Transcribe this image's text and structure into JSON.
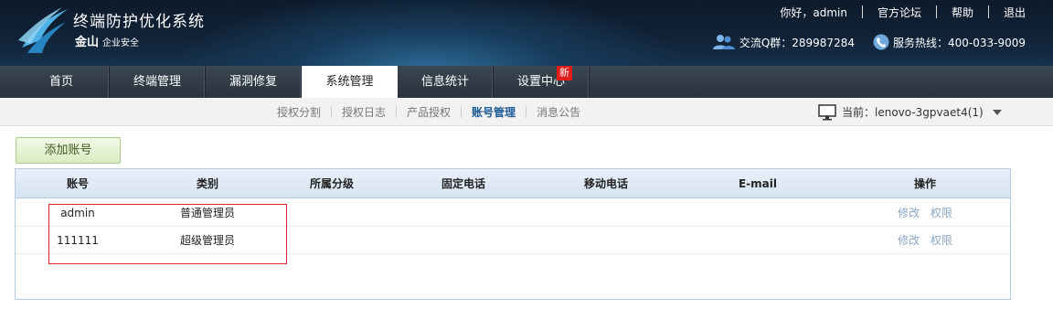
{
  "header": {
    "app_title": "终端防护优化系统",
    "brand": "金山",
    "brand_sub": "企业安全",
    "greeting": "你好，admin",
    "links": [
      "官方论坛",
      "帮助",
      "退出"
    ],
    "qq_group": "交流Q群：289987284",
    "hotline": "服务热线：400-033-9009",
    "accent_color": "#1e5b94"
  },
  "nav": {
    "items": [
      {
        "label": "首页"
      },
      {
        "label": "终端管理"
      },
      {
        "label": "漏洞修复"
      },
      {
        "label": "系统管理"
      },
      {
        "label": "信息统计"
      },
      {
        "label": "设置中心"
      }
    ],
    "active": "系统管理",
    "new_badge": "新"
  },
  "subnav": {
    "items": [
      {
        "label": "授权分割"
      },
      {
        "label": "授权日志"
      },
      {
        "label": "产品授权"
      },
      {
        "label": "账号管理"
      },
      {
        "label": "消息公告"
      }
    ],
    "active": "账号管理",
    "current": "当前：lenovo-3gpvaet4(1)"
  },
  "toolbar": {
    "add_label": "添加账号"
  },
  "table": {
    "columns": [
      "账号",
      "类别",
      "所属分级",
      "固定电话",
      "移动电话",
      "E-mail",
      "操作"
    ],
    "rows": [
      {
        "account": "admin",
        "type": "普通管理员",
        "group": "",
        "phone": "",
        "mobile": "",
        "email": "",
        "edit": "修改",
        "perm": "权限"
      },
      {
        "account": "111111",
        "type": "超级管理员",
        "group": "",
        "phone": "",
        "mobile": "",
        "email": "",
        "edit": "修改",
        "perm": "权限"
      }
    ]
  }
}
